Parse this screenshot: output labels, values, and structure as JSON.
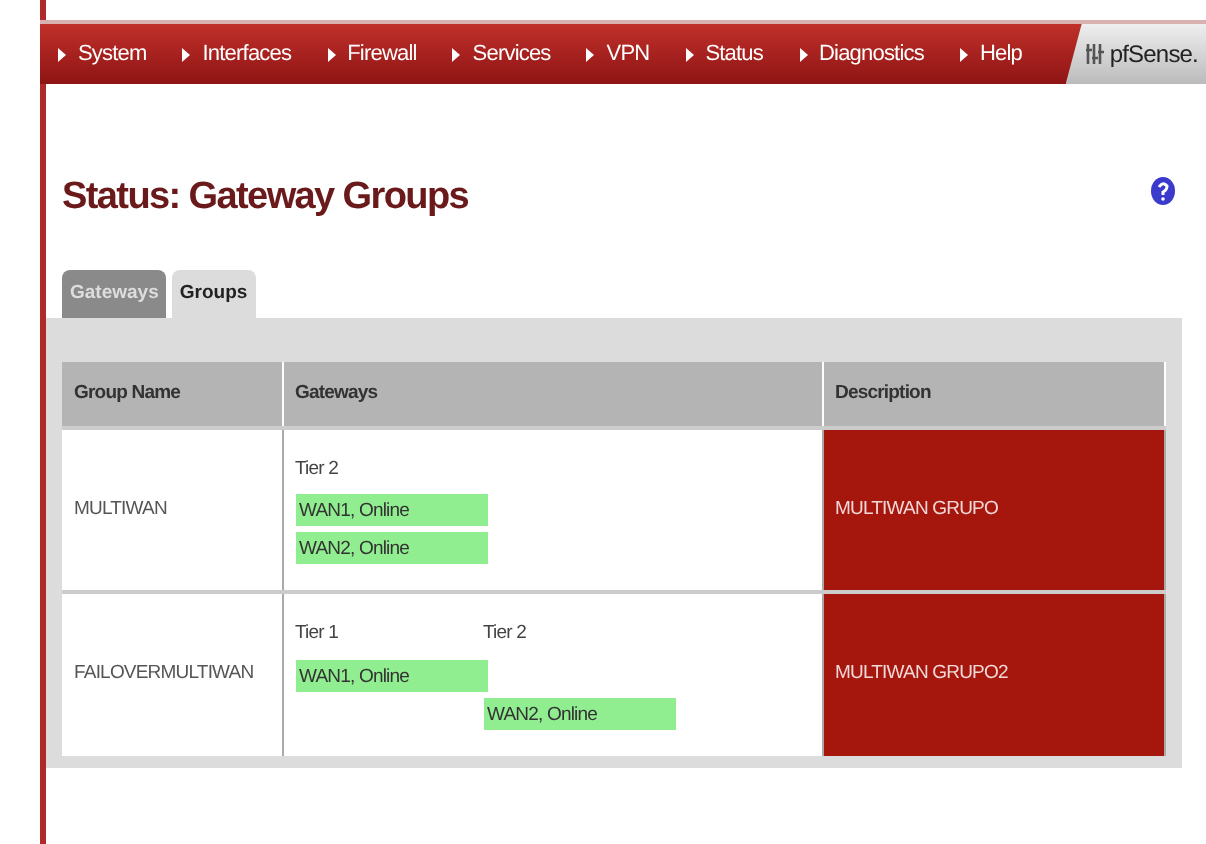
{
  "nav": {
    "items": [
      "System",
      "Interfaces",
      "Firewall",
      "Services",
      "VPN",
      "Status",
      "Diagnostics",
      "Help"
    ],
    "logo": "pfSense."
  },
  "page": {
    "title": "Status: Gateway Groups"
  },
  "tabs": [
    {
      "label": "Gateways",
      "selected": false
    },
    {
      "label": "Groups",
      "selected": true
    }
  ],
  "table": {
    "columns": [
      "Group Name",
      "Gateways",
      "Description"
    ],
    "rows": [
      {
        "name": "MULTIWAN",
        "tiers": [
          "Tier 2"
        ],
        "lines": [
          [
            {
              "kind": "status",
              "text": "WAN1, Online"
            }
          ],
          [
            {
              "kind": "status",
              "text": "WAN2, Online"
            }
          ]
        ],
        "description": "MULTIWAN GRUPO"
      },
      {
        "name": "FAILOVERMULTIWAN",
        "tiers": [
          "Tier 1",
          "Tier 2"
        ],
        "lines": [
          [
            {
              "kind": "status",
              "text": "WAN1, Online"
            }
          ],
          [
            {
              "kind": "blank"
            },
            {
              "kind": "status",
              "text": "WAN2, Online"
            }
          ]
        ],
        "description": "MULTIWAN GRUPO2"
      }
    ]
  }
}
